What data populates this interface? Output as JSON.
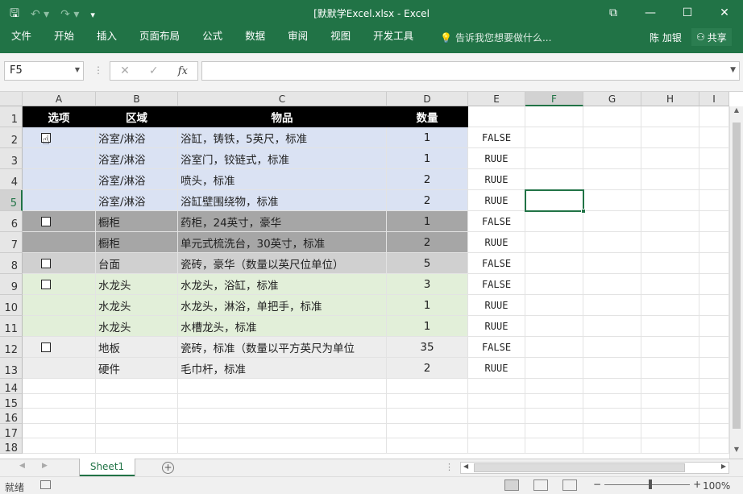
{
  "window": {
    "title": "[默默学Excel.xlsx - Excel",
    "controls": [
      "⧉",
      "—",
      "☐",
      "✕"
    ]
  },
  "ribbon": {
    "tabs": [
      "文件",
      "开始",
      "插入",
      "页面布局",
      "公式",
      "数据",
      "审阅",
      "视图",
      "开发工具"
    ],
    "tell_me": "告诉我您想要做什么...",
    "user": "陈 加银",
    "share": "共享"
  },
  "formula_bar": {
    "name_box": "F5",
    "fx": "fx",
    "formula": ""
  },
  "columns": [
    "A",
    "B",
    "C",
    "D",
    "E",
    "F",
    "G",
    "H",
    "I"
  ],
  "rows": [
    "1",
    "2",
    "3",
    "4",
    "5",
    "6",
    "7",
    "8",
    "9",
    "10",
    "11",
    "12",
    "13",
    "14",
    "15",
    "16",
    "17",
    "18"
  ],
  "table": {
    "headers": [
      "选项",
      "区域",
      "物品",
      "数量"
    ],
    "data": [
      {
        "checkbox": true,
        "area": "浴室/淋浴",
        "item": "浴缸，铸铁，5英尺，标准",
        "qty": "1",
        "flag": "FALSE",
        "color": "#dae2f3"
      },
      {
        "checkbox": false,
        "area": "浴室/淋浴",
        "item": "浴室门，铰链式，标准",
        "qty": "1",
        "flag": "RUUE",
        "color": "#dae2f3"
      },
      {
        "checkbox": false,
        "area": "浴室/淋浴",
        "item": "喷头，标准",
        "qty": "2",
        "flag": "RUUE",
        "color": "#dae2f3"
      },
      {
        "checkbox": false,
        "area": "浴室/淋浴",
        "item": "浴缸壁围绕物，标准",
        "qty": "2",
        "flag": "RUUE",
        "color": "#dae2f3"
      },
      {
        "checkbox": true,
        "area": "橱柜",
        "item": "药柜，24英寸，豪华",
        "qty": "1",
        "flag": "FALSE",
        "color": "#a6a6a6"
      },
      {
        "checkbox": false,
        "area": "橱柜",
        "item": "单元式梳洗台，30英寸，标准",
        "qty": "2",
        "flag": "RUUE",
        "color": "#a6a6a6"
      },
      {
        "checkbox": true,
        "area": "台面",
        "item": "瓷砖，豪华（数量以英尺位单位）",
        "qty": "5",
        "flag": "FALSE",
        "color": "#d0d0d0"
      },
      {
        "checkbox": true,
        "area": "水龙头",
        "item": "水龙头，浴缸，标准",
        "qty": "3",
        "flag": "FALSE",
        "color": "#e2efd9"
      },
      {
        "checkbox": false,
        "area": "水龙头",
        "item": "水龙头，淋浴，单把手，标准",
        "qty": "1",
        "flag": "RUUE",
        "color": "#e2efd9"
      },
      {
        "checkbox": false,
        "area": "水龙头",
        "item": "水槽龙头，标准",
        "qty": "1",
        "flag": "RUUE",
        "color": "#e2efd9"
      },
      {
        "checkbox": true,
        "area": "地板",
        "item": "瓷砖，标准（数量以平方英尺为单位",
        "qty": "35",
        "flag": "FALSE",
        "color": "#ededed"
      },
      {
        "checkbox": false,
        "area": "硬件",
        "item": "毛巾杆，标准",
        "qty": "2",
        "flag": "RUUE",
        "color": "#ededed"
      }
    ]
  },
  "selected_cell": {
    "col": "F",
    "row": "5"
  },
  "sheets": [
    "Sheet1"
  ],
  "status": {
    "text": "就绪",
    "zoom": "100%"
  }
}
